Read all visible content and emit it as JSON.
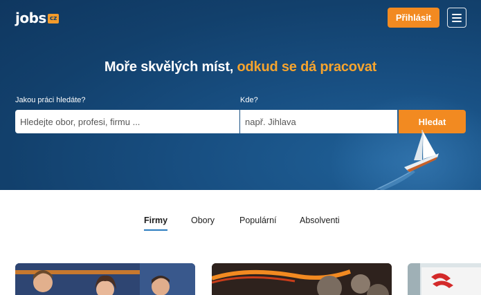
{
  "header": {
    "logo_text": "jobs",
    "logo_badge": "cz",
    "login_label": "Přihlásit",
    "menu_icon": "hamburger-icon"
  },
  "hero": {
    "headline_main": "Moře skvělých míst, ",
    "headline_accent": "odkud se dá pracovat",
    "what_label": "Jakou práci hledáte?",
    "what_placeholder": "Hledejte obor, profesi, firmu ...",
    "where_label": "Kde?",
    "where_placeholder": "např. Jihlava",
    "search_label": "Hledat",
    "illustration": "sailboat-icon"
  },
  "tabs": [
    {
      "label": "Firmy",
      "active": true
    },
    {
      "label": "Obory",
      "active": false
    },
    {
      "label": "Populární",
      "active": false
    },
    {
      "label": "Absolventi",
      "active": false
    }
  ],
  "cards": [
    {
      "image": "team-photo"
    },
    {
      "image": "landscape-photo"
    },
    {
      "image": "company-logo-photo"
    }
  ],
  "colors": {
    "hero_background": "#12406c",
    "accent_orange": "#f28a21",
    "headline_accent": "#f6a42e",
    "tab_underline": "#2a7bbf"
  }
}
